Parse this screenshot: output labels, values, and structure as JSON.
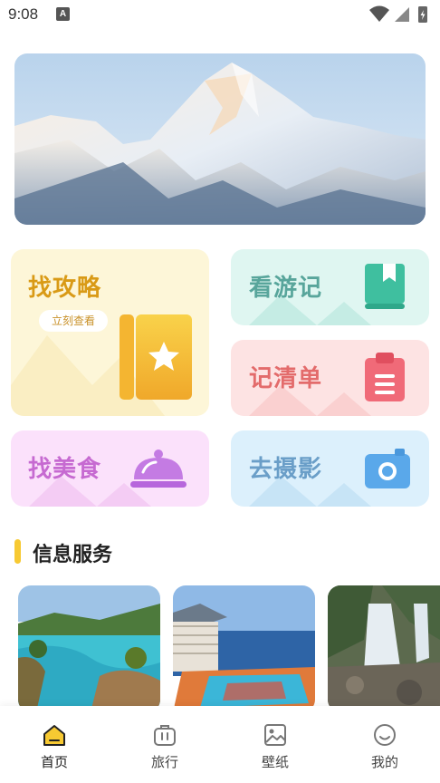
{
  "status_bar": {
    "time": "9:08",
    "notification_badge": "A"
  },
  "cards": {
    "guide": {
      "title": "找攻略",
      "pill": "立刻查看",
      "color": "#d99a16"
    },
    "notes": {
      "title": "看游记",
      "color": "#58a59b"
    },
    "list": {
      "title": "记清单",
      "color": "#e36b6b"
    },
    "food": {
      "title": "找美食",
      "color": "#c66ad1"
    },
    "photo": {
      "title": "去摄影",
      "color": "#6a9ec8"
    }
  },
  "section": {
    "title": "信息服务",
    "accent": "#f7c932"
  },
  "tabs": [
    {
      "label": "首页",
      "icon": "home-icon",
      "active": true
    },
    {
      "label": "旅行",
      "icon": "suitcase-icon",
      "active": false
    },
    {
      "label": "壁纸",
      "icon": "image-icon",
      "active": false
    },
    {
      "label": "我的",
      "icon": "smile-icon",
      "active": false
    }
  ]
}
